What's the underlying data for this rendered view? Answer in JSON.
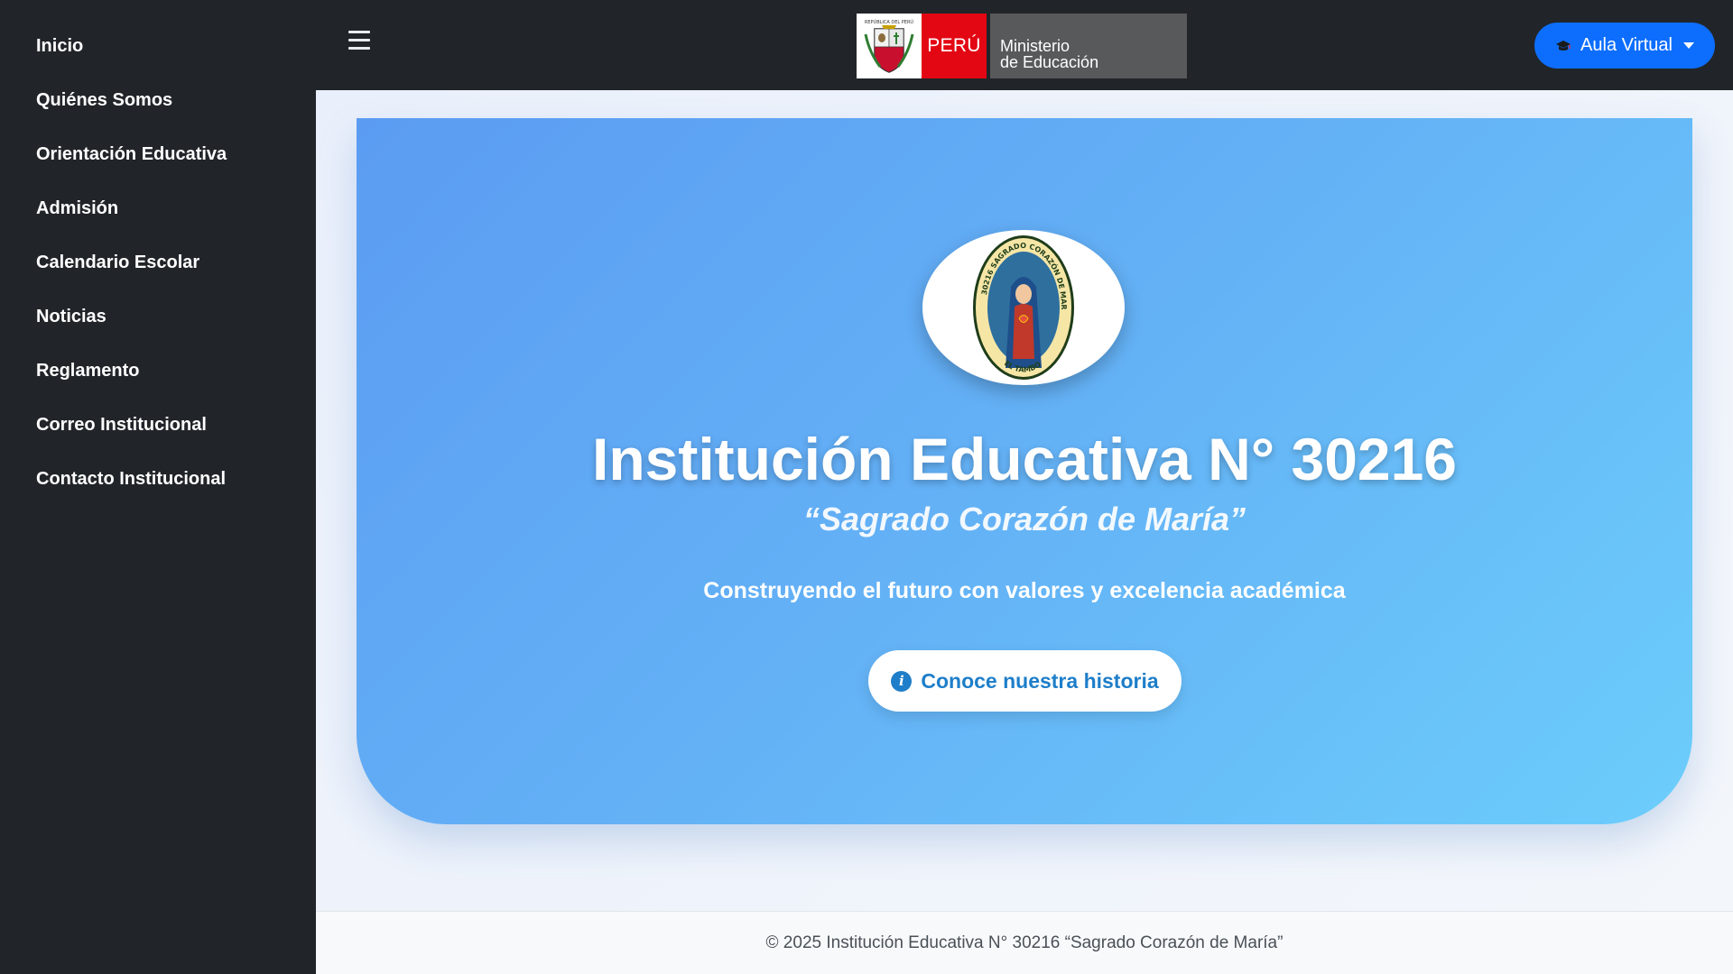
{
  "sidebar": {
    "items": [
      {
        "label": "Inicio"
      },
      {
        "label": "Quiénes Somos"
      },
      {
        "label": "Orientación Educativa"
      },
      {
        "label": "Admisión"
      },
      {
        "label": "Calendario Escolar"
      },
      {
        "label": "Noticias"
      },
      {
        "label": "Reglamento"
      },
      {
        "label": "Correo Institucional"
      },
      {
        "label": "Contacto Institucional"
      }
    ]
  },
  "header": {
    "menu_icon": "hamburger-icon",
    "brand": {
      "country": "PERÚ",
      "ministry_line1": "Ministerio",
      "ministry_line2": "de Educación",
      "shield_icon": "peru-coat-of-arms-icon"
    },
    "aula_button": {
      "label": "Aula Virtual",
      "icon": "graduation-cap-icon",
      "color": "#0d6efd"
    }
  },
  "hero": {
    "logo_icon": "school-seal-logo",
    "title": "Institución Educativa N° 30216",
    "subtitle": "“Sagrado Corazón de María”",
    "tagline": "Construyendo el futuro con valores y excelencia académica",
    "cta_label": "Conoce nuestra historia",
    "cta_icon": "info-icon",
    "gradient": [
      "#5b9cf2",
      "#6ccdfb"
    ]
  },
  "footer": {
    "text": "© 2025 Institución Educativa N° 30216 “Sagrado Corazón de María”"
  },
  "colors": {
    "sidebar_bg": "#212529",
    "accent": "#1e7ec9",
    "peru_red": "#e30613",
    "minedu_gray": "#58595b"
  }
}
